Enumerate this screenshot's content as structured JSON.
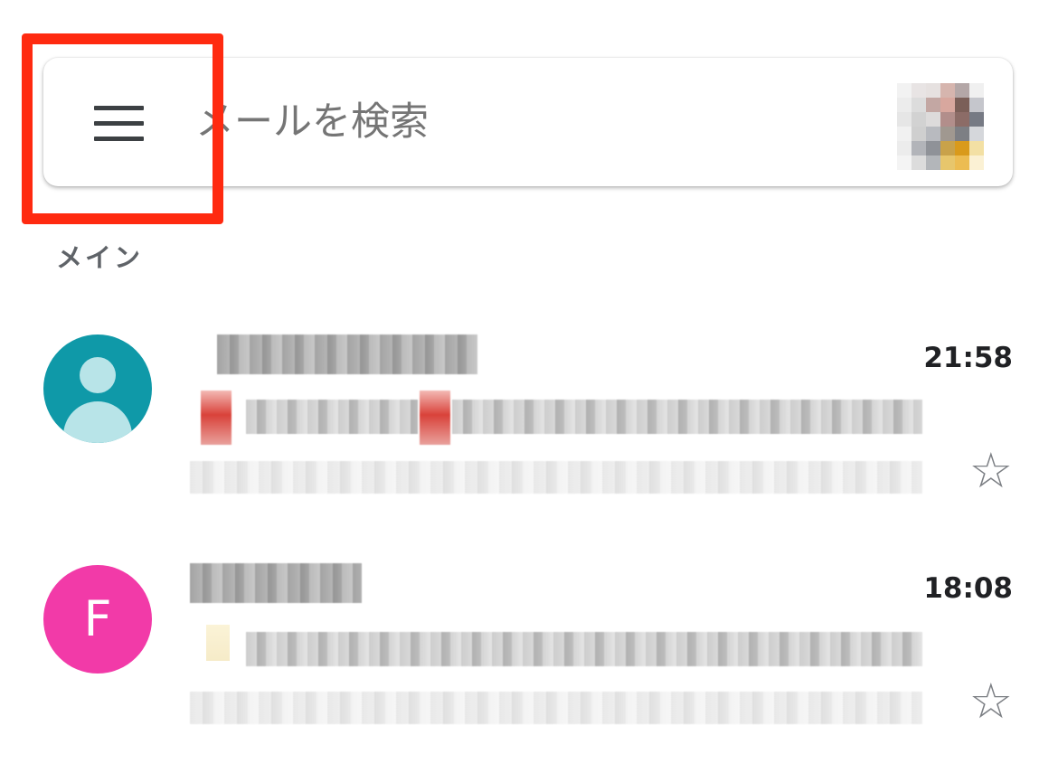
{
  "search": {
    "placeholder": "メールを検索",
    "menu_icon": "hamburger-menu-icon",
    "account_icon": "account-avatar-icon"
  },
  "section": {
    "label": "メイン"
  },
  "mails": [
    {
      "avatar_icon": "person-icon",
      "avatar_color": "#0f99a8",
      "time": "21:58",
      "star_icon": "star-outline-icon"
    },
    {
      "avatar_letter": "F",
      "avatar_color": "#f23aa8",
      "time": "18:08",
      "star_icon": "star-outline-icon"
    }
  ],
  "colors": {
    "highlight": "#ff2a10"
  }
}
